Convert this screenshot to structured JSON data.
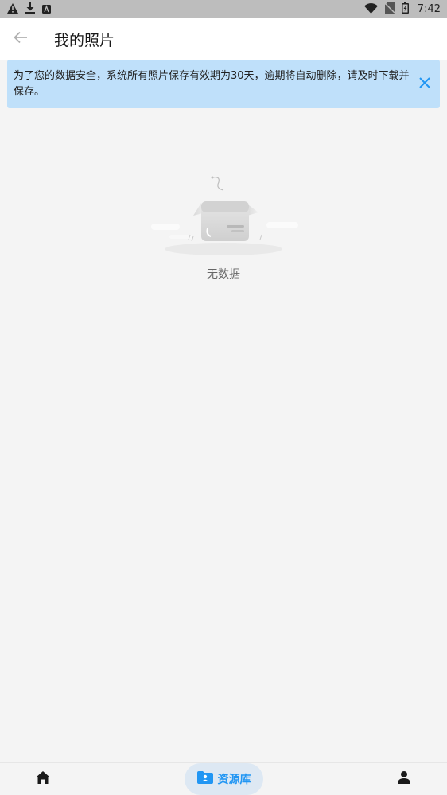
{
  "status_bar": {
    "time": "7:42",
    "left_icons": [
      "warning-icon",
      "download-icon",
      "a-badge-icon"
    ],
    "right_icons": [
      "wifi-icon",
      "no-sim-icon",
      "battery-icon"
    ]
  },
  "header": {
    "title": "我的照片",
    "back_icon": "arrow-left-icon"
  },
  "notice": {
    "text": "为了您的数据安全，系统所有照片保存有效期为30天，逾期将自动删除，请及时下载并保存。",
    "close_icon": "close-icon",
    "accent": "#2196f3",
    "background": "#bfe0fa"
  },
  "empty_state": {
    "illustration": "empty-box-icon",
    "text": "无数据"
  },
  "bottom_nav": {
    "items": [
      {
        "icon": "home-icon",
        "label": ""
      },
      {
        "icon": "folder-person-icon",
        "label": "资源库",
        "active": true
      },
      {
        "icon": "person-icon",
        "label": ""
      }
    ]
  }
}
